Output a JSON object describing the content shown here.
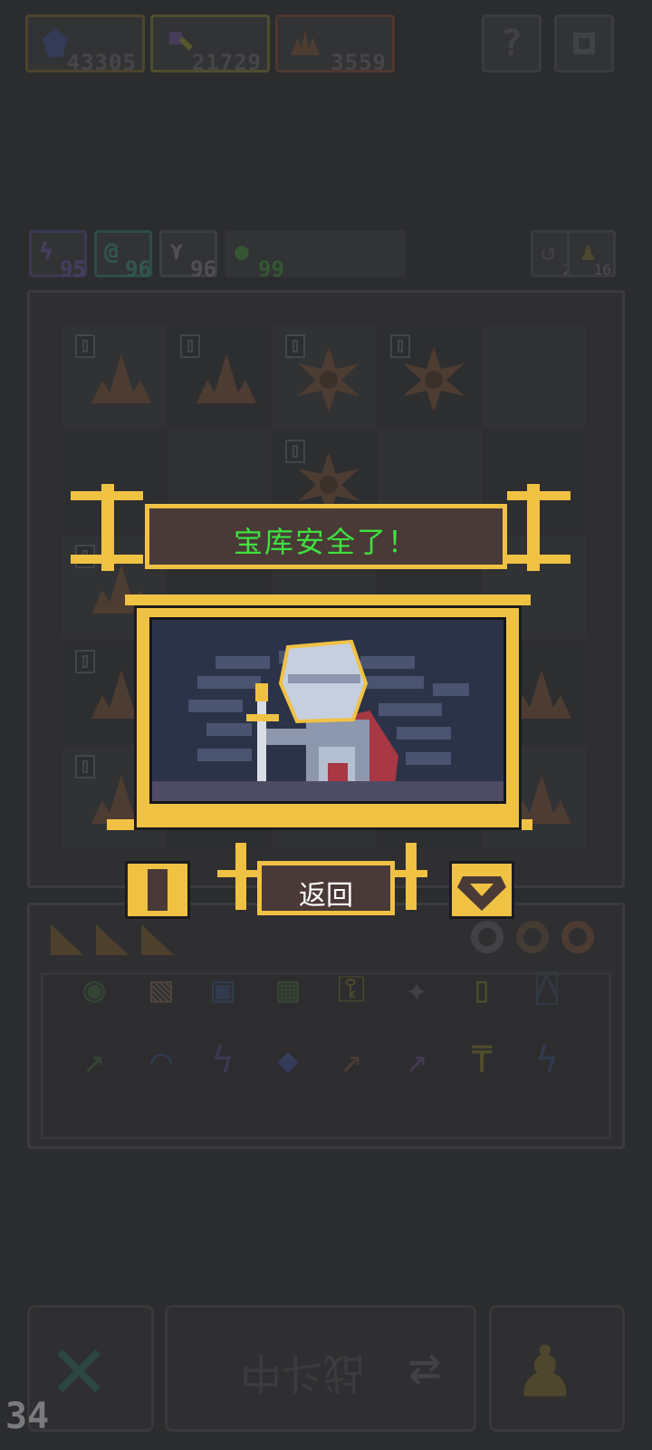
{
  "resources": [
    {
      "name": "mana-crystal",
      "value": "43305",
      "color": "#6f5a2e"
    },
    {
      "name": "magic-key",
      "value": "21729",
      "color": "#7d7a30"
    },
    {
      "name": "leaf-material",
      "value": "3559",
      "color": "#7a4f3b"
    }
  ],
  "top_buttons": {
    "help_label": "?",
    "settings_icon": "gear-icon"
  },
  "stats": [
    {
      "name": "lightning",
      "value": "95",
      "color": "#5b4f8a"
    },
    {
      "name": "spiral",
      "value": "96",
      "color": "#3a7a6e"
    },
    {
      "name": "wings",
      "value": "96",
      "color": "#5d5e60"
    },
    {
      "name": "potion",
      "value": "99",
      "color": "#3f7a3a"
    }
  ],
  "small_buttons": [
    {
      "name": "undo",
      "value": "2"
    },
    {
      "name": "pawn",
      "value": "16"
    }
  ],
  "modal": {
    "title": "宝库安全了！",
    "back_label": "返回",
    "accent": "#f0c244",
    "title_color": "#3ee33e"
  },
  "bottom_bar": {
    "middle_label": "战斗中",
    "counter": "34"
  },
  "cell_tag_value": "0"
}
